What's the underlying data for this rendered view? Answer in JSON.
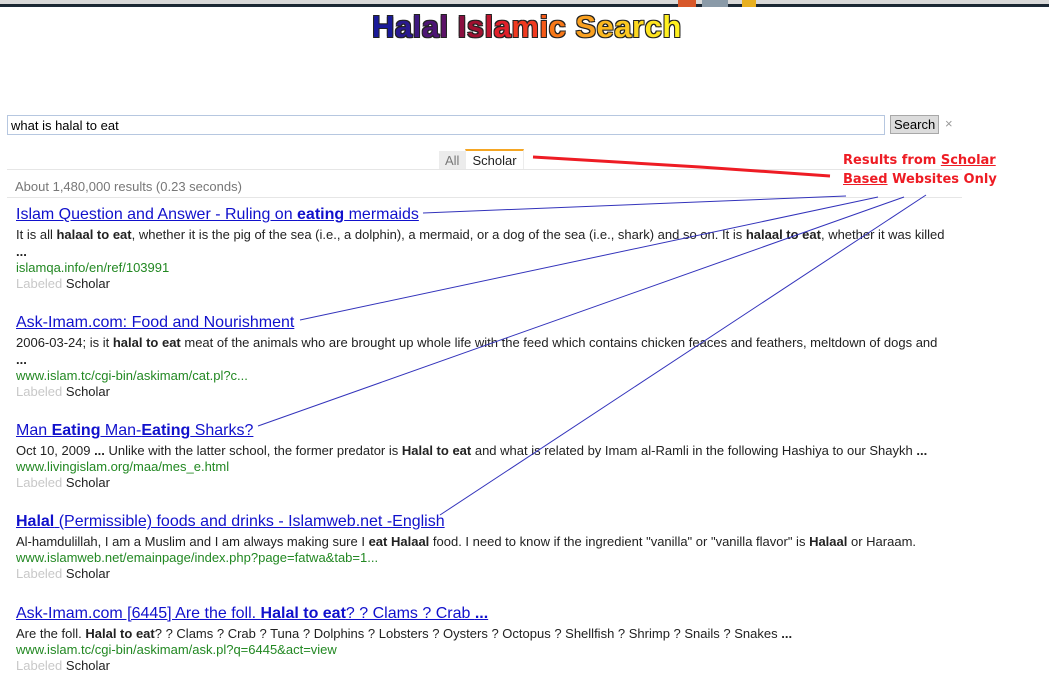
{
  "browser_taskbar": {
    "items": [
      "chrome-tab-icon",
      "tab-icon",
      "app-icon"
    ]
  },
  "logo": {
    "letters": [
      {
        "ch": "H",
        "color": "#1a1a9a"
      },
      {
        "ch": "a",
        "color": "#2a1a90"
      },
      {
        "ch": "l",
        "color": "#3d1880"
      },
      {
        "ch": "a",
        "color": "#4d1575"
      },
      {
        "ch": "l",
        "color": "#5c1268"
      },
      {
        "ch": " ",
        "color": "#000000"
      },
      {
        "ch": "I",
        "color": "#8a1040"
      },
      {
        "ch": "s",
        "color": "#a01030"
      },
      {
        "ch": "l",
        "color": "#c01530"
      },
      {
        "ch": "a",
        "color": "#e0202a"
      },
      {
        "ch": "m",
        "color": "#f03a20"
      },
      {
        "ch": "i",
        "color": "#f55a18"
      },
      {
        "ch": "c",
        "color": "#f87818"
      },
      {
        "ch": " ",
        "color": "#000000"
      },
      {
        "ch": "S",
        "color": "#f9a020"
      },
      {
        "ch": "e",
        "color": "#fab820"
      },
      {
        "ch": "a",
        "color": "#fcc820"
      },
      {
        "ch": "r",
        "color": "#fdd820"
      },
      {
        "ch": "c",
        "color": "#fee420"
      },
      {
        "ch": "h",
        "color": "#fff020"
      }
    ],
    "text": "Halal Islamic Search"
  },
  "search": {
    "query": "what is halal to eat",
    "button_label": "Search",
    "clear_label": "×"
  },
  "tabs": [
    {
      "label": "All",
      "active": false
    },
    {
      "label": "Scholar",
      "active": true
    }
  ],
  "stats": "About 1,480,000 results (0.23 seconds)",
  "callout": {
    "line1_prefix": "Results from ",
    "line1_link": "Scholar",
    "line2_link": "Based",
    "line2_suffix": " Websites Only",
    "color": "#ee1c24"
  },
  "results": [
    {
      "title_parts": [
        {
          "t": "Islam Question and Answer - Ruling on ",
          "b": false
        },
        {
          "t": "eating",
          "b": true
        },
        {
          "t": " mermaids",
          "b": false
        }
      ],
      "snippet_parts": [
        {
          "t": "It is all ",
          "b": false
        },
        {
          "t": "halaal to eat",
          "b": true
        },
        {
          "t": ", whether it is the pig of the sea (i.e., a dolphin), a mermaid, or a dog of the sea (i.e., shark) and so on. It is ",
          "b": false
        },
        {
          "t": "halaal to eat",
          "b": true
        },
        {
          "t": ", whether it was killed ",
          "b": false
        },
        {
          "t": "...",
          "b": true
        }
      ],
      "url": "islamqa.info/en/ref/103991",
      "label_prefix": "Labeled",
      "label": "Scholar"
    },
    {
      "title_parts": [
        {
          "t": "Ask-Imam.com: Food and Nourishment",
          "b": false
        }
      ],
      "snippet_parts": [
        {
          "t": "2006-03-24; is it ",
          "b": false
        },
        {
          "t": "halal to eat",
          "b": true
        },
        {
          "t": " meat of the animals who are brought up whole life with the feed which contains chicken feaces and feathers, meltdown of dogs and ",
          "b": false
        },
        {
          "t": "...",
          "b": true
        }
      ],
      "url": "www.islam.tc/cgi-bin/askimam/cat.pl?c...",
      "label_prefix": "Labeled",
      "label": "Scholar"
    },
    {
      "title_parts": [
        {
          "t": "Man ",
          "b": false
        },
        {
          "t": "Eating",
          "b": true
        },
        {
          "t": " Man-",
          "b": false
        },
        {
          "t": "Eating",
          "b": true
        },
        {
          "t": " Sharks?",
          "b": false
        }
      ],
      "snippet_parts": [
        {
          "t": "Oct 10, 2009 ",
          "b": false
        },
        {
          "t": "...",
          "b": true
        },
        {
          "t": " Unlike with the latter school, the former predator is ",
          "b": false
        },
        {
          "t": "Halal to eat",
          "b": true
        },
        {
          "t": " and what is related by Imam al-Ramli in the following Hashiya to our Shaykh ",
          "b": false
        },
        {
          "t": "...",
          "b": true
        }
      ],
      "url": "www.livingislam.org/maa/mes_e.html",
      "label_prefix": "Labeled",
      "label": "Scholar"
    },
    {
      "title_parts": [
        {
          "t": "Halal",
          "b": true
        },
        {
          "t": " (Permissible) foods and drinks - Islamweb.net -English",
          "b": false
        }
      ],
      "snippet_parts": [
        {
          "t": "Al-hamdulillah, I am a Muslim and I am always making sure I ",
          "b": false
        },
        {
          "t": "eat Halaal",
          "b": true
        },
        {
          "t": " food. I need to know if the ingredient \"vanilla\" or \"vanilla flavor\" is ",
          "b": false
        },
        {
          "t": "Halaal",
          "b": true
        },
        {
          "t": " or Haraam.",
          "b": false
        }
      ],
      "url": "www.islamweb.net/emainpage/index.php?page=fatwa&tab=1...",
      "label_prefix": "Labeled",
      "label": "Scholar"
    },
    {
      "title_parts": [
        {
          "t": "Ask-Imam.com [6445] Are the foll. ",
          "b": false
        },
        {
          "t": "Halal to eat",
          "b": true
        },
        {
          "t": "? ? Clams ? Crab ",
          "b": false
        },
        {
          "t": "...",
          "b": true
        }
      ],
      "snippet_parts": [
        {
          "t": "Are the foll. ",
          "b": false
        },
        {
          "t": "Halal to eat",
          "b": true
        },
        {
          "t": "? ? Clams ? Crab ? Tuna ? Dolphins ? Lobsters ? Oysters ? Octopus ? Shellfish ? Shrimp ? Snails ? Snakes ",
          "b": false
        },
        {
          "t": "...",
          "b": true
        }
      ],
      "url": "www.islam.tc/cgi-bin/askimam/ask.pl?q=6445&act=view",
      "label_prefix": "Labeled",
      "label": "Scholar"
    }
  ]
}
